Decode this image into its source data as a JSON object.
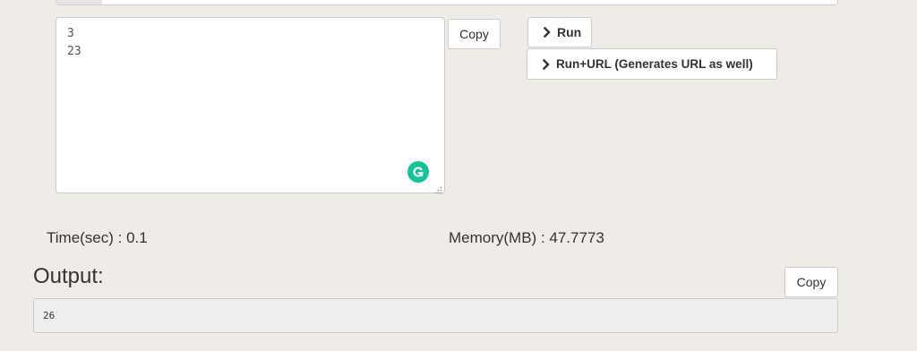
{
  "input": {
    "lines": "3\n23"
  },
  "buttons": {
    "copy_input_label": "Copy",
    "run_label": "Run",
    "run_url_label": "Run+URL (Generates URL as well)",
    "copy_output_label": "Copy"
  },
  "stats": {
    "time_text": "Time(sec) : 0.1",
    "memory_text": "Memory(MB) : 47.7773"
  },
  "output": {
    "heading": "Output:",
    "value": "26"
  },
  "icons": {
    "grammarly": "grammarly-icon",
    "chevron": "chevron-right-icon",
    "resize": "resize-handle-icon"
  },
  "colors": {
    "page_background": "#efebe7",
    "grammarly_green": "#15c39a",
    "output_background": "#eeeeee"
  }
}
